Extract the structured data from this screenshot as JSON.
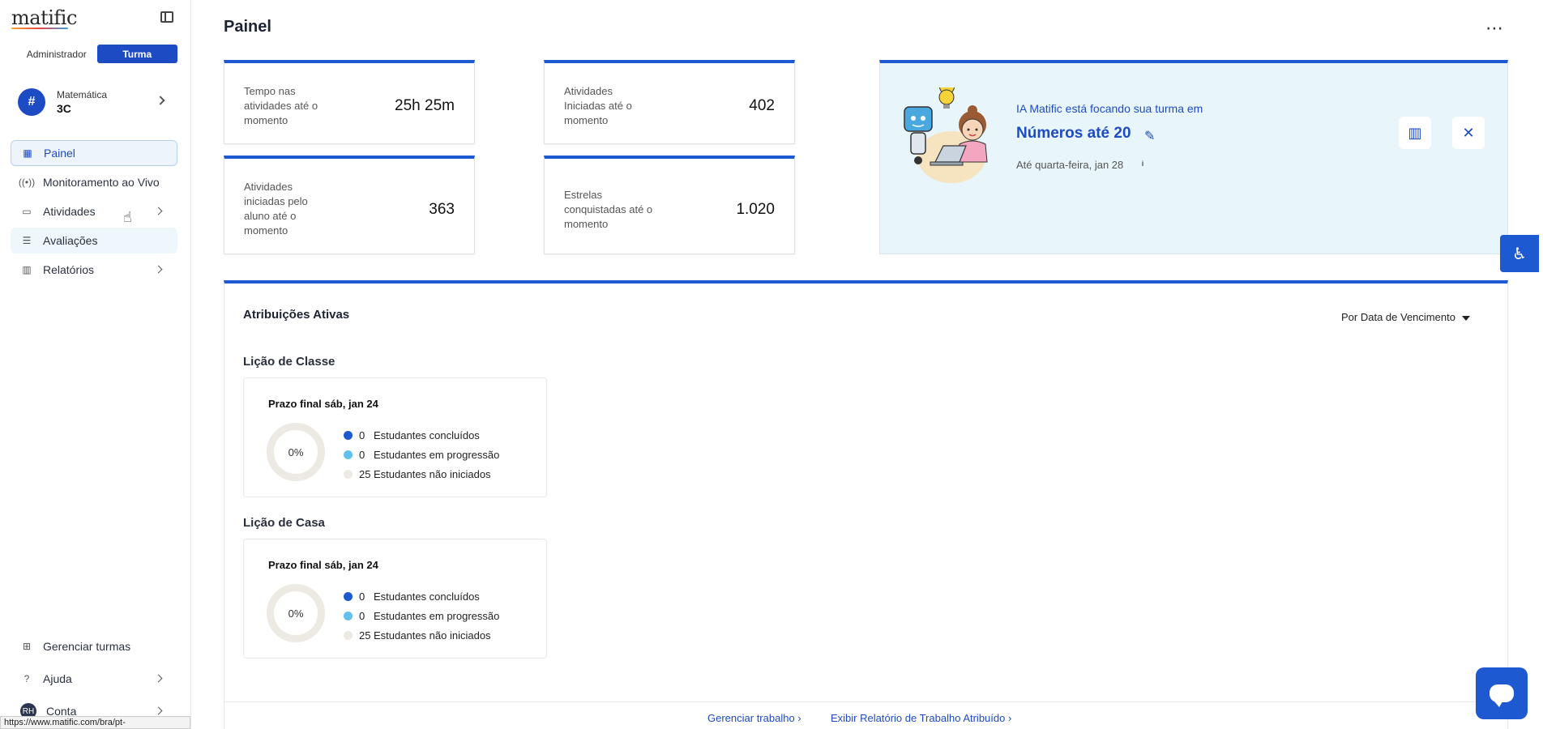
{
  "app": {
    "logo": "matific",
    "status_url": "https://www.matific.com/bra/pt-br/teachers/assessments"
  },
  "role_toggle": {
    "admin": "Administrador",
    "class": "Turma"
  },
  "class_selector": {
    "subject": "Matemática",
    "name": "3C"
  },
  "sidebar": {
    "items": [
      {
        "label": "Painel",
        "icon": "dashboard-icon"
      },
      {
        "label": "Monitoramento ao Vivo",
        "icon": "live-monitor-icon"
      },
      {
        "label": "Atividades",
        "icon": "laptop-icon"
      },
      {
        "label": "Avaliações",
        "icon": "checklist-icon"
      },
      {
        "label": "Relatórios",
        "icon": "bar-chart-icon"
      }
    ],
    "bottom": [
      {
        "label": "Gerenciar turmas",
        "icon": "classes-icon"
      },
      {
        "label": "Ajuda",
        "icon": "help-icon"
      },
      {
        "label": "Conta",
        "avatar": "RH"
      }
    ]
  },
  "header": {
    "title": "Painel",
    "more": "⋯"
  },
  "stats": [
    {
      "label": "Tempo nas atividades até o momento",
      "value": "25h 25m"
    },
    {
      "label": "Atividades Iniciadas até o momento",
      "value": "402"
    },
    {
      "label": "Atividades iniciadas pelo aluno até o momento",
      "value": "363"
    },
    {
      "label": "Estrelas conquistadas até o momento",
      "value": "1.020"
    }
  ],
  "ai": {
    "line1": "IA Matific está focando sua turma em",
    "topic": "Números até 20",
    "date": "Até quarta-feira, jan 28",
    "info": "i"
  },
  "assignments": {
    "title": "Atribuições Ativas",
    "sort": "Por Data de Vencimento",
    "sections": [
      {
        "title": "Lição de Classe",
        "due": "Prazo final sáb, jan 24",
        "percent": "0%",
        "legend": [
          {
            "count": "0",
            "label": "Estudantes concluídos",
            "color": "#1d5ad1"
          },
          {
            "count": "0",
            "label": "Estudantes em progressão",
            "color": "#62c1ec"
          },
          {
            "count": "25",
            "label": "Estudantes não iniciados",
            "color": "#eceae3"
          }
        ]
      },
      {
        "title": "Lição de Casa",
        "due": "Prazo final sáb, jan 24",
        "percent": "0%",
        "legend": [
          {
            "count": "0",
            "label": "Estudantes concluídos",
            "color": "#1d5ad1"
          },
          {
            "count": "0",
            "label": "Estudantes em progressão",
            "color": "#62c1ec"
          },
          {
            "count": "25",
            "label": "Estudantes não iniciados",
            "color": "#eceae3"
          }
        ]
      }
    ],
    "footer": {
      "manage": "Gerenciar trabalho",
      "report": "Exibir Relatório de Trabalho Atribuído"
    }
  }
}
